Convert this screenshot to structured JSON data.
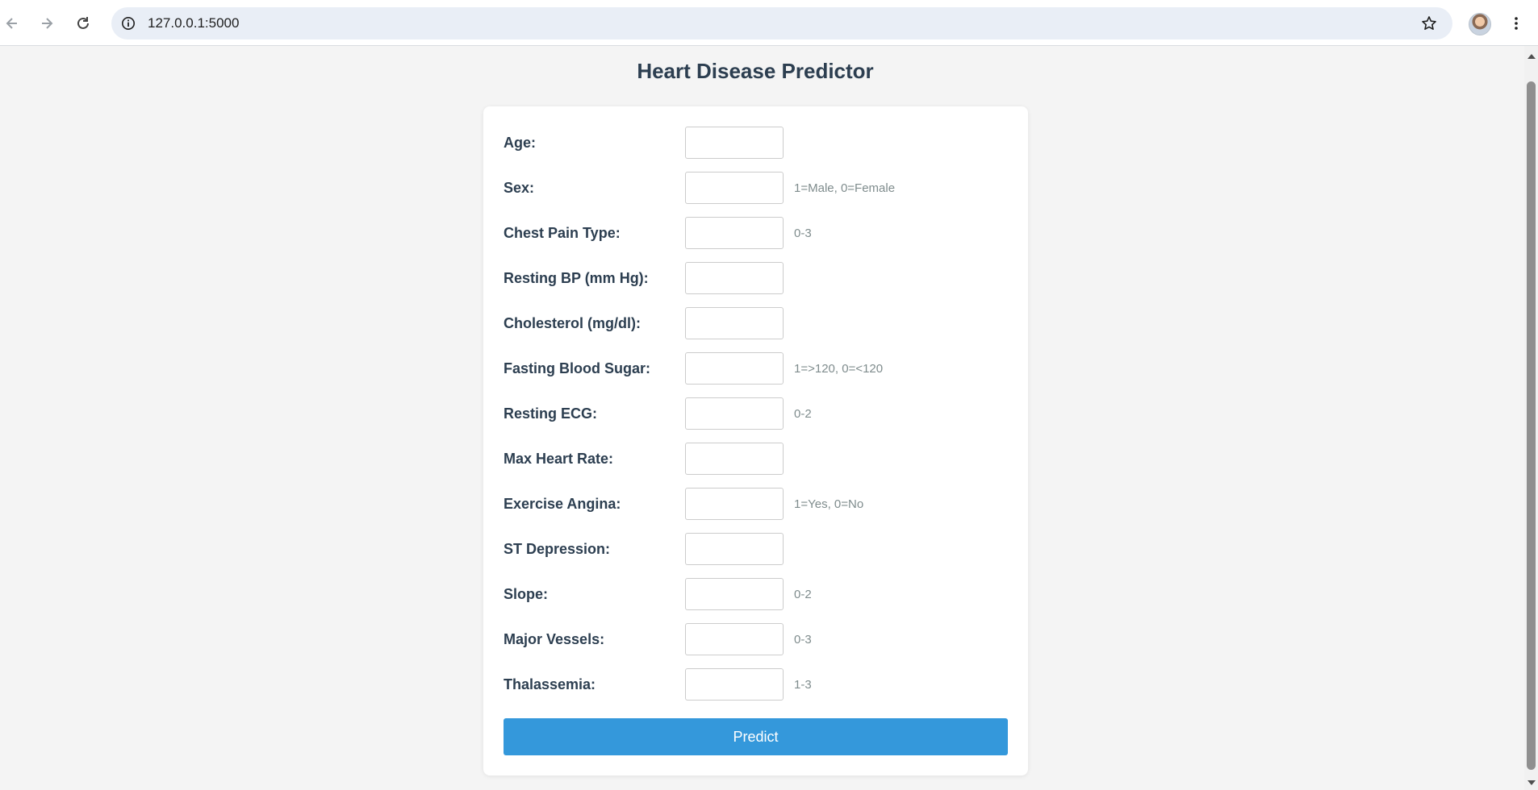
{
  "browser": {
    "url": "127.0.0.1:5000"
  },
  "page": {
    "title": "Heart Disease Predictor"
  },
  "form": {
    "fields": [
      {
        "label": "Age:",
        "hint": ""
      },
      {
        "label": "Sex:",
        "hint": "1=Male, 0=Female"
      },
      {
        "label": "Chest Pain Type:",
        "hint": "0-3"
      },
      {
        "label": "Resting BP (mm Hg):",
        "hint": ""
      },
      {
        "label": "Cholesterol (mg/dl):",
        "hint": ""
      },
      {
        "label": "Fasting Blood Sugar:",
        "hint": "1=>120, 0=<120"
      },
      {
        "label": "Resting ECG:",
        "hint": "0-2"
      },
      {
        "label": "Max Heart Rate:",
        "hint": ""
      },
      {
        "label": "Exercise Angina:",
        "hint": "1=Yes, 0=No"
      },
      {
        "label": "ST Depression:",
        "hint": ""
      },
      {
        "label": "Slope:",
        "hint": "0-2"
      },
      {
        "label": "Major Vessels:",
        "hint": "0-3"
      },
      {
        "label": "Thalassemia:",
        "hint": "1-3"
      }
    ],
    "submit_label": "Predict"
  },
  "colors": {
    "accent": "#3498db",
    "heading": "#2c3e50",
    "hint": "#7f8c8d",
    "background": "#f4f4f4"
  }
}
